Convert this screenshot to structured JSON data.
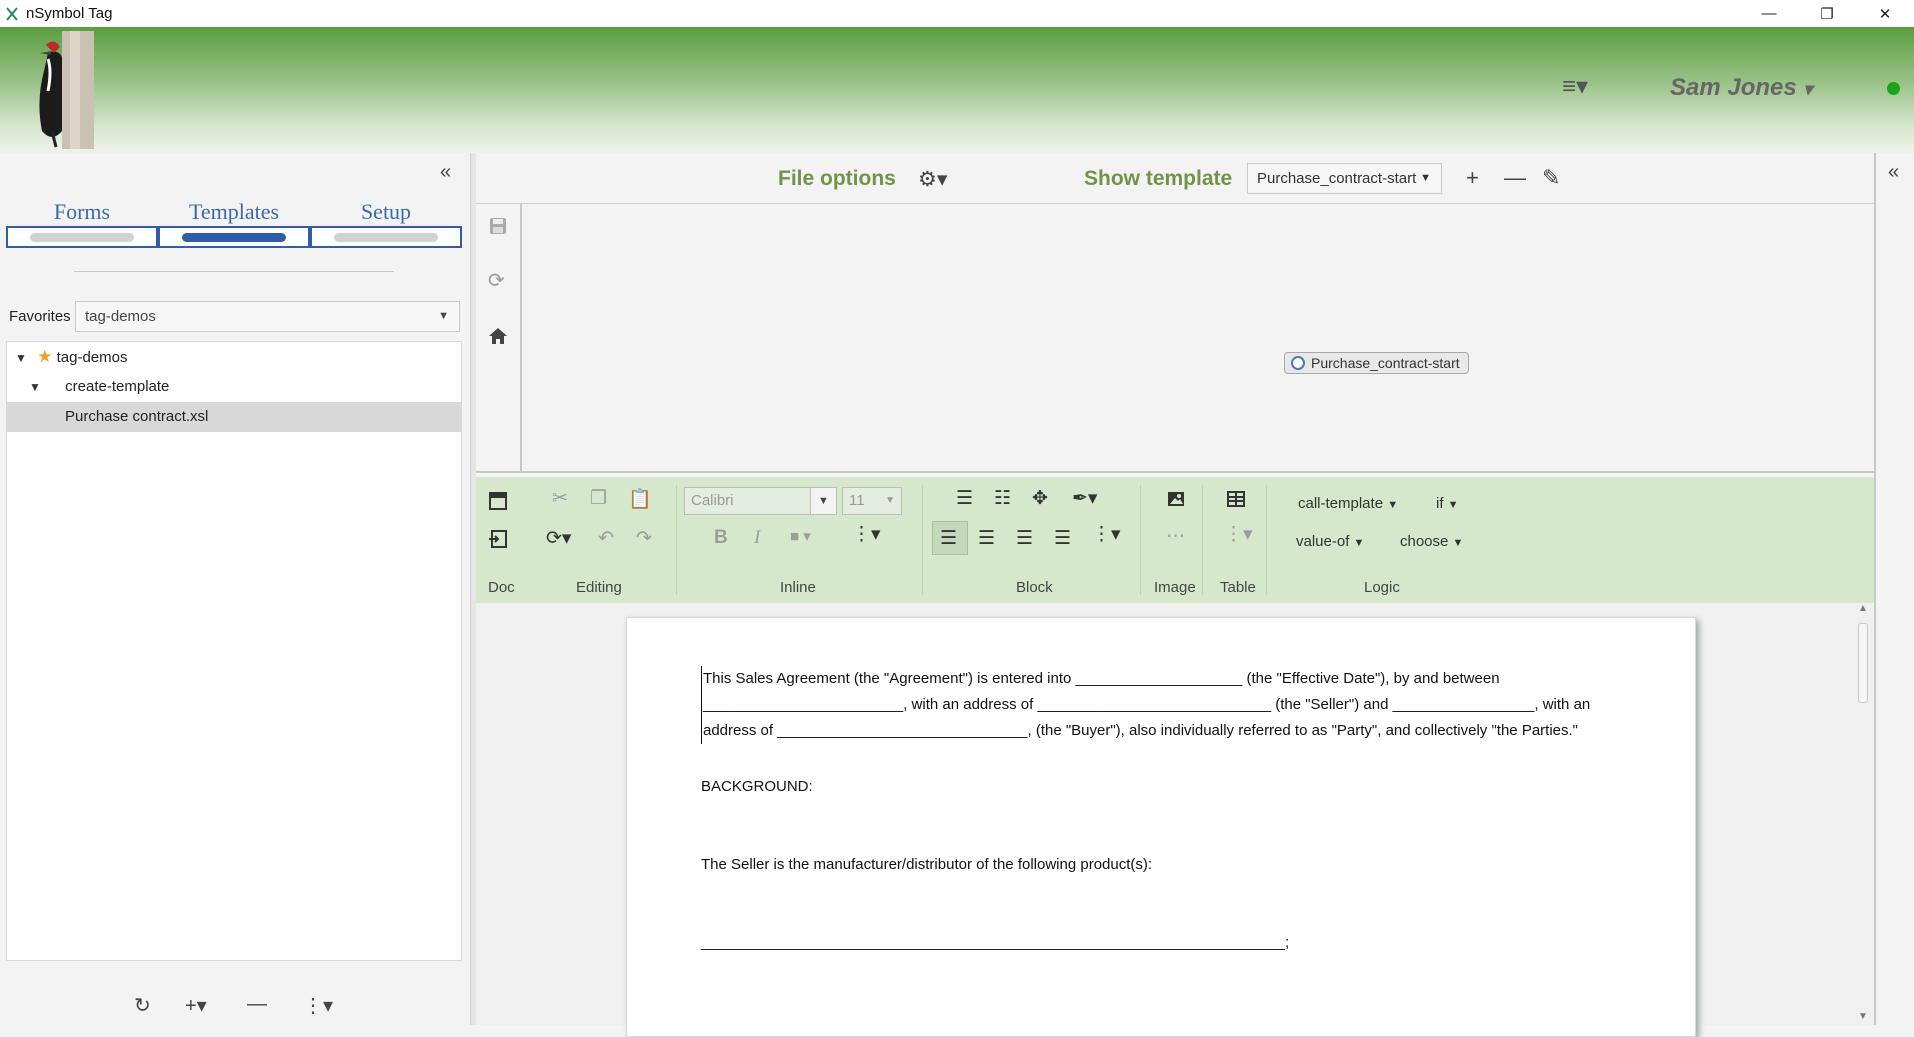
{
  "window": {
    "title": "nSymbol Tag",
    "minimize": "—",
    "maximize": "❐",
    "close": "✕"
  },
  "header": {
    "user_name": "Sam Jones",
    "user_caret": "▾",
    "menu_icon": "≡▾"
  },
  "left": {
    "collapse_icon": "«",
    "tabs": [
      {
        "label": "Forms",
        "active": false
      },
      {
        "label": "Templates",
        "active": true
      },
      {
        "label": "Setup",
        "active": false
      }
    ],
    "favorites_label": "Favorites",
    "favorites_value": "tag-demos",
    "tree": [
      {
        "label": "tag-demos",
        "level": 0,
        "expanded": true,
        "starred": true
      },
      {
        "label": "create-template",
        "level": 1,
        "expanded": true
      },
      {
        "label": "Purchase contract.xsl",
        "level": 2,
        "selected": true
      }
    ],
    "footer": {
      "refresh": "↻",
      "add": "+▾",
      "remove": "—",
      "more": "⋮▾"
    }
  },
  "topbar": {
    "file_options": "File options",
    "gear": "⚙▾",
    "show_template": "Show template",
    "template_select": "Purchase_contract-start",
    "add": "+",
    "remove": "—",
    "edit": "✎"
  },
  "canvas": {
    "node_label": "Purchase_contract-start"
  },
  "ribbon": {
    "font": "Calibri",
    "size": "11",
    "groups": [
      "Doc",
      "Editing",
      "Inline",
      "Block",
      "Image",
      "Table",
      "Logic"
    ],
    "logic": {
      "call_template": "call-template",
      "if": "if",
      "value_of": "value-of",
      "choose": "choose"
    }
  },
  "document": {
    "p1": "This Sales Agreement (the \"Agreement\") is entered into ____________________ (the \"Effective Date\"), by and between ________________________, with an address of ____________________________ (the \"Seller\") and _________________, with an address of ______________________________, (the \"Buyer\"), also individually referred to as \"Party\", and collectively \"the Parties.\"",
    "p2": "BACKGROUND:",
    "p3": "The Seller is the manufacturer/distributor of the following product(s):",
    "p4": "______________________________________________________________________;"
  },
  "right": {
    "collapse_icon": "«"
  }
}
